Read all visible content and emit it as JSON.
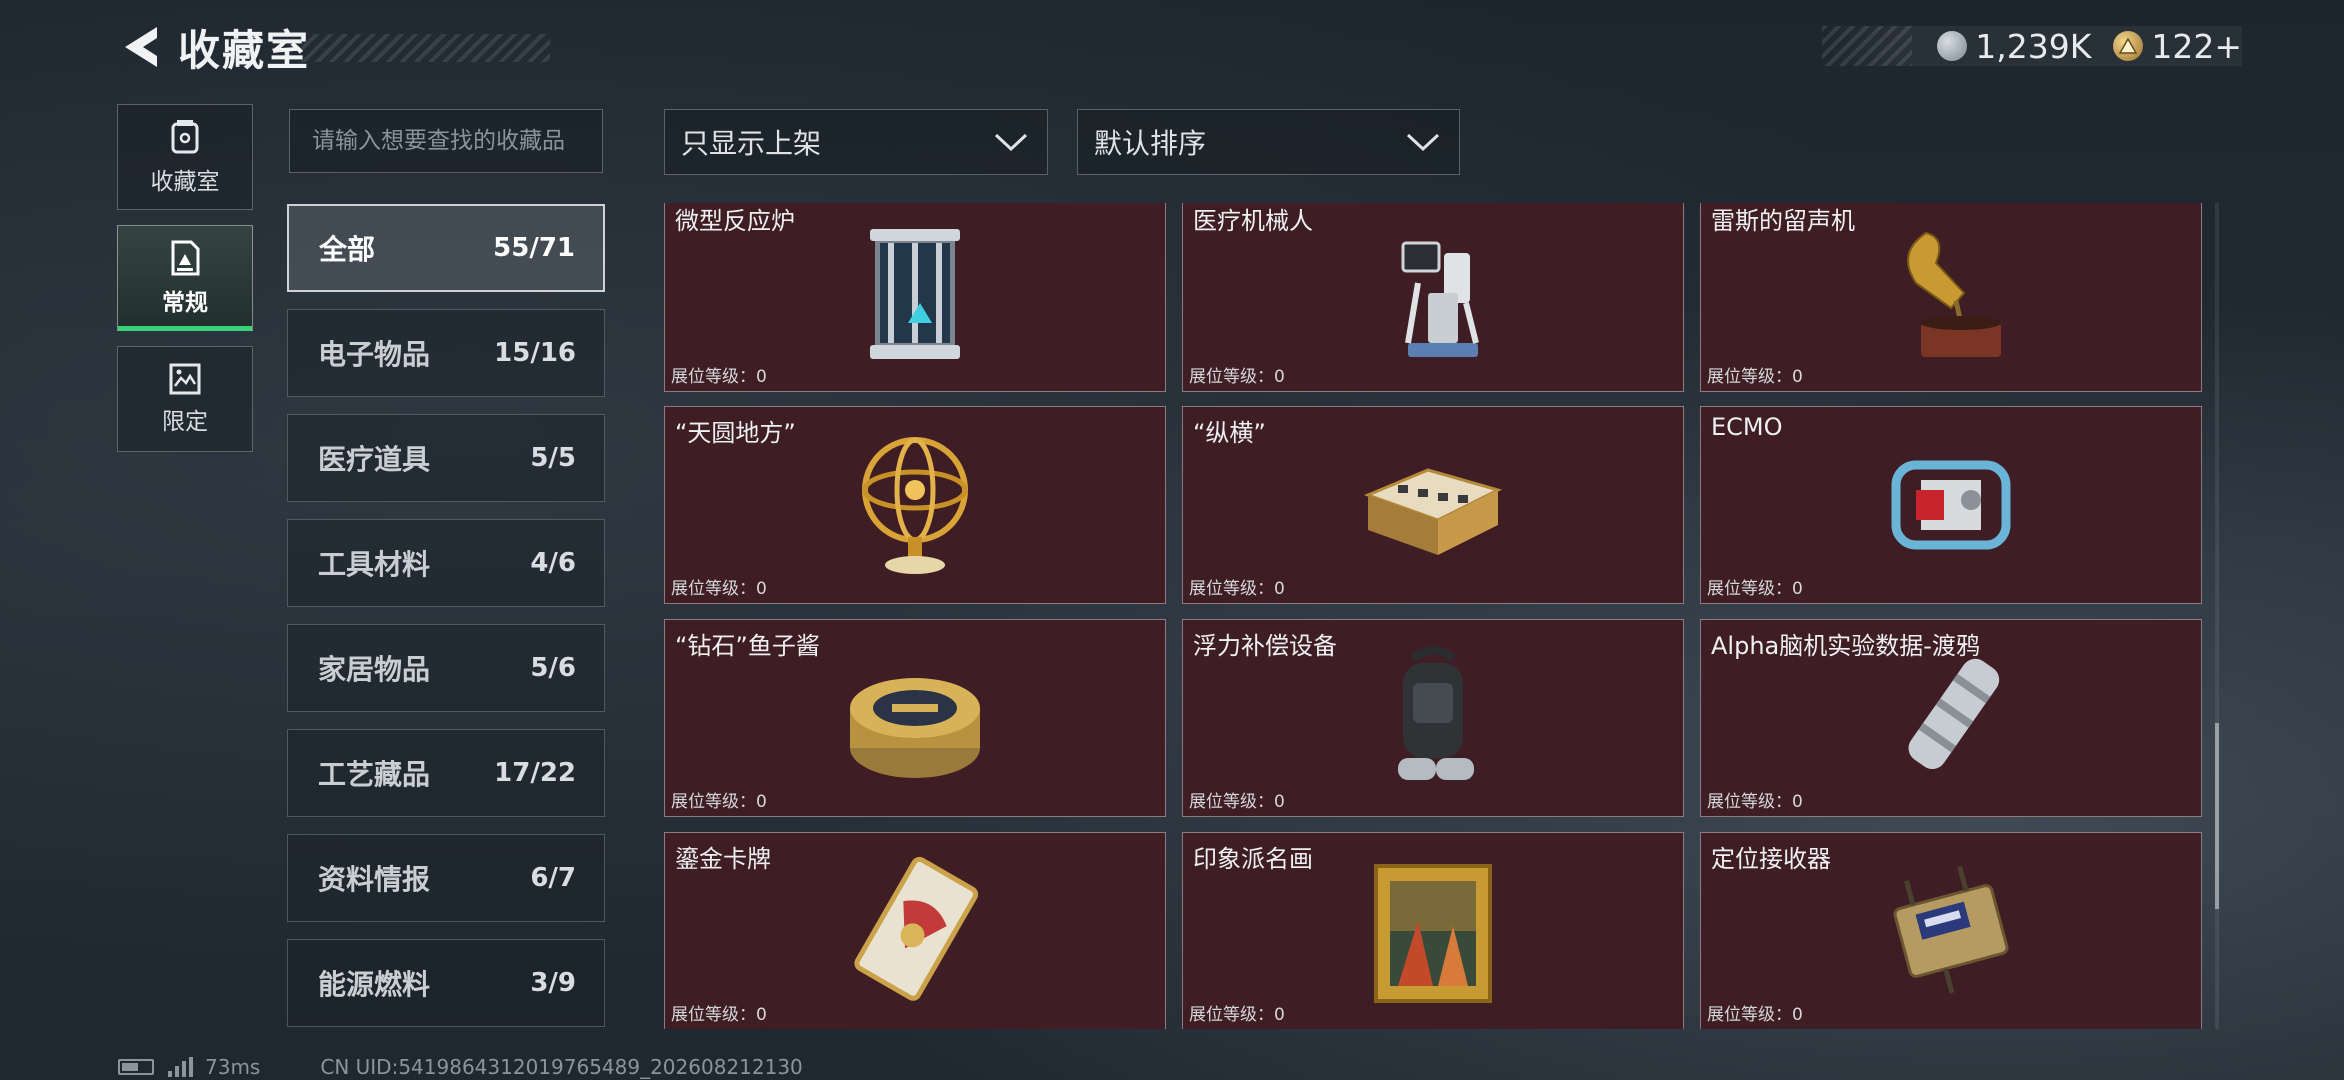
{
  "header": {
    "title": "收藏室"
  },
  "currency": [
    {
      "icon": "silver-coin-icon",
      "value": "1,239K"
    },
    {
      "icon": "gold-pyramid-coin-icon",
      "value": "122+"
    }
  ],
  "rail": [
    {
      "label": "收藏室",
      "icon": "collection-room-icon"
    },
    {
      "label": "常规",
      "icon": "regular-icon"
    },
    {
      "label": "限定",
      "icon": "limited-icon"
    }
  ],
  "search": {
    "placeholder": "请输入想要查找的收藏品"
  },
  "categories": [
    {
      "name": "全部",
      "count": "55/71"
    },
    {
      "name": "电子物品",
      "count": "15/16"
    },
    {
      "name": "医疗道具",
      "count": "5/5"
    },
    {
      "name": "工具材料",
      "count": "4/6"
    },
    {
      "name": "家居物品",
      "count": "5/6"
    },
    {
      "name": "工艺藏品",
      "count": "17/22"
    },
    {
      "name": "资料情报",
      "count": "6/7"
    },
    {
      "name": "能源燃料",
      "count": "3/9"
    }
  ],
  "filters": {
    "shelf": "只显示上架",
    "sort": "默认排序"
  },
  "level_label": "展位等级：0",
  "items": [
    {
      "name": "微型反应炉",
      "icon": "micro-reactor-icon"
    },
    {
      "name": "医疗机械人",
      "icon": "medical-robot-icon"
    },
    {
      "name": "雷斯的留声机",
      "icon": "gramophone-icon"
    },
    {
      "name": "“天圆地方”",
      "icon": "armillary-sphere-icon"
    },
    {
      "name": "“纵横”",
      "icon": "chess-box-icon"
    },
    {
      "name": "ECMO",
      "icon": "ecmo-machine-icon"
    },
    {
      "name": "“钻石”鱼子酱",
      "icon": "caviar-tin-icon"
    },
    {
      "name": "浮力补偿设备",
      "icon": "buoyancy-device-icon"
    },
    {
      "name": "Alpha脑机实验数据-渡鸦",
      "icon": "data-cylinder-icon"
    },
    {
      "name": "鎏金卡牌",
      "icon": "gilded-card-icon"
    },
    {
      "name": "印象派名画",
      "icon": "framed-painting-icon"
    },
    {
      "name": "定位接收器",
      "icon": "locator-receiver-icon"
    }
  ],
  "footer": {
    "ping": "73ms",
    "uid": "CN UID:5419864312019765489_202608212130"
  },
  "colors": {
    "card_bg": "#3f1d24",
    "active_accent": "#39d27a"
  }
}
